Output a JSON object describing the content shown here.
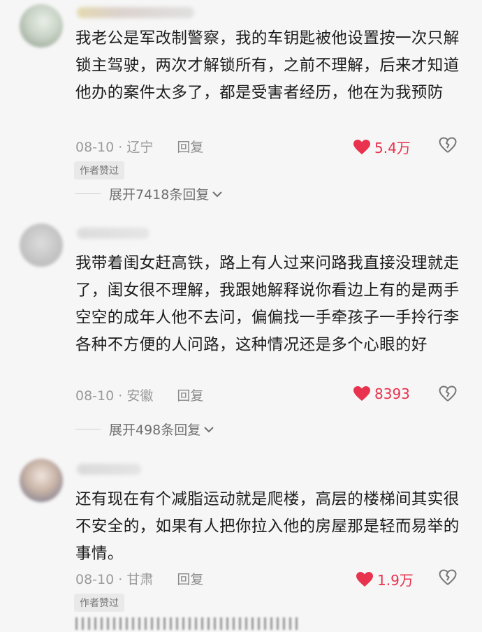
{
  "comments": [
    {
      "text": "我老公是军改制警察，我的车钥匙被他设置按一次只解锁主驾驶，两次才解锁所有，之前不理解，后来才知道他办的案件太多了，都是受害者经历，他在为我预防",
      "date": "08-10",
      "location": "辽宁",
      "reply_label": "回复",
      "likes": "5.4万",
      "badge": "作者赞过",
      "expand": "展开7418条回复"
    },
    {
      "text": "我带着闺女赶高铁，路上有人过来问路我直接没理就走了，闺女很不理解，我跟她解释说你看边上有的是两手空空的成年人他不去问，偏偏找一手牵孩子一手拎行李各种不方便的人问路，这种情况还是多个心眼的好",
      "date": "08-10",
      "location": "安徽",
      "reply_label": "回复",
      "likes": "8393",
      "expand": "展开498条回复"
    },
    {
      "text": "还有现在有个减脂运动就是爬楼，高层的楼梯间其实很不安全的，如果有人把你拉入他的房屋那是轻而易举的事情。",
      "date": "08-10",
      "location": "甘肃",
      "reply_label": "回复",
      "likes": "1.9万",
      "badge": "作者赞过"
    }
  ],
  "colors": {
    "like": "#e8324e",
    "meta": "#9a9a9a",
    "text": "#1d1d1d"
  }
}
